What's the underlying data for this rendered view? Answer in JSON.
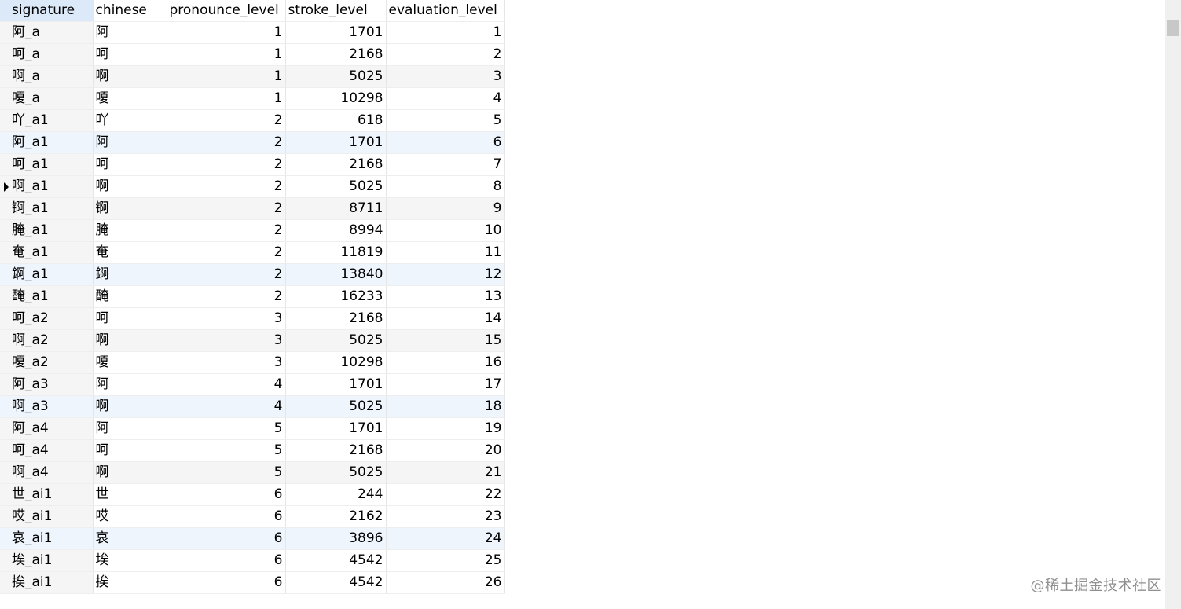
{
  "columns": [
    "signature",
    "chinese",
    "pronounce_level",
    "stroke_level",
    "evaluation_level"
  ],
  "current_row_index": 7,
  "rows": [
    [
      "阿_a",
      "阿",
      "1",
      "1701",
      "1"
    ],
    [
      "呵_a",
      "呵",
      "1",
      "2168",
      "2"
    ],
    [
      "啊_a",
      "啊",
      "1",
      "5025",
      "3"
    ],
    [
      "嗄_a",
      "嗄",
      "1",
      "10298",
      "4"
    ],
    [
      "吖_a1",
      "吖",
      "2",
      "618",
      "5"
    ],
    [
      "阿_a1",
      "阿",
      "2",
      "1701",
      "6"
    ],
    [
      "呵_a1",
      "呵",
      "2",
      "2168",
      "7"
    ],
    [
      "啊_a1",
      "啊",
      "2",
      "5025",
      "8"
    ],
    [
      "锕_a1",
      "锕",
      "2",
      "8711",
      "9"
    ],
    [
      "腌_a1",
      "腌",
      "2",
      "8994",
      "10"
    ],
    [
      "奄_a1",
      "奄",
      "2",
      "11819",
      "11"
    ],
    [
      "錒_a1",
      "錒",
      "2",
      "13840",
      "12"
    ],
    [
      "醃_a1",
      "醃",
      "2",
      "16233",
      "13"
    ],
    [
      "呵_a2",
      "呵",
      "3",
      "2168",
      "14"
    ],
    [
      "啊_a2",
      "啊",
      "3",
      "5025",
      "15"
    ],
    [
      "嗄_a2",
      "嗄",
      "3",
      "10298",
      "16"
    ],
    [
      "阿_a3",
      "阿",
      "4",
      "1701",
      "17"
    ],
    [
      "啊_a3",
      "啊",
      "4",
      "5025",
      "18"
    ],
    [
      "阿_a4",
      "阿",
      "5",
      "1701",
      "19"
    ],
    [
      "呵_a4",
      "呵",
      "5",
      "2168",
      "20"
    ],
    [
      "啊_a4",
      "啊",
      "5",
      "5025",
      "21"
    ],
    [
      "世_ai1",
      "世",
      "6",
      "244",
      "22"
    ],
    [
      "哎_ai1",
      "哎",
      "6",
      "2162",
      "23"
    ],
    [
      "哀_ai1",
      "哀",
      "6",
      "3896",
      "24"
    ],
    [
      "埃_ai1",
      "埃",
      "6",
      "4542",
      "25"
    ],
    [
      "挨_ai1",
      "挨",
      "6",
      "4542",
      "26"
    ]
  ],
  "watermark": "@稀土掘金技术社区"
}
